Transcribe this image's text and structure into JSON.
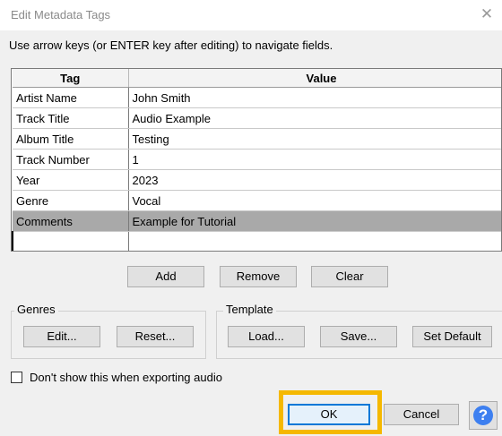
{
  "window": {
    "title": "Edit Metadata Tags",
    "close_glyph": "✕"
  },
  "instruction": "Use arrow keys (or ENTER key after editing) to navigate fields.",
  "table": {
    "headers": [
      "Tag",
      "Value"
    ],
    "rows": [
      {
        "tag": "Artist Name",
        "value": "John Smith"
      },
      {
        "tag": "Track Title",
        "value": "Audio Example"
      },
      {
        "tag": "Album Title",
        "value": "Testing"
      },
      {
        "tag": "Track Number",
        "value": "1"
      },
      {
        "tag": "Year",
        "value": "2023"
      },
      {
        "tag": "Genre",
        "value": "Vocal"
      },
      {
        "tag": "Comments",
        "value": "Example for Tutorial"
      },
      {
        "tag": "",
        "value": ""
      }
    ],
    "selected_row": "Comments"
  },
  "row_buttons": {
    "add": "Add",
    "remove": "Remove",
    "clear": "Clear"
  },
  "genres": {
    "label": "Genres",
    "edit": "Edit...",
    "reset": "Reset..."
  },
  "template": {
    "label": "Template",
    "load": "Load...",
    "save": "Save...",
    "set_default": "Set Default"
  },
  "checkbox": {
    "label": "Don't show this when exporting audio",
    "checked": false
  },
  "footer": {
    "ok": "OK",
    "cancel": "Cancel",
    "help_glyph": "?"
  },
  "colors": {
    "highlight": "#f5b800",
    "selected_row": "#a9a9a9",
    "help_icon": "#3d7ff0"
  }
}
